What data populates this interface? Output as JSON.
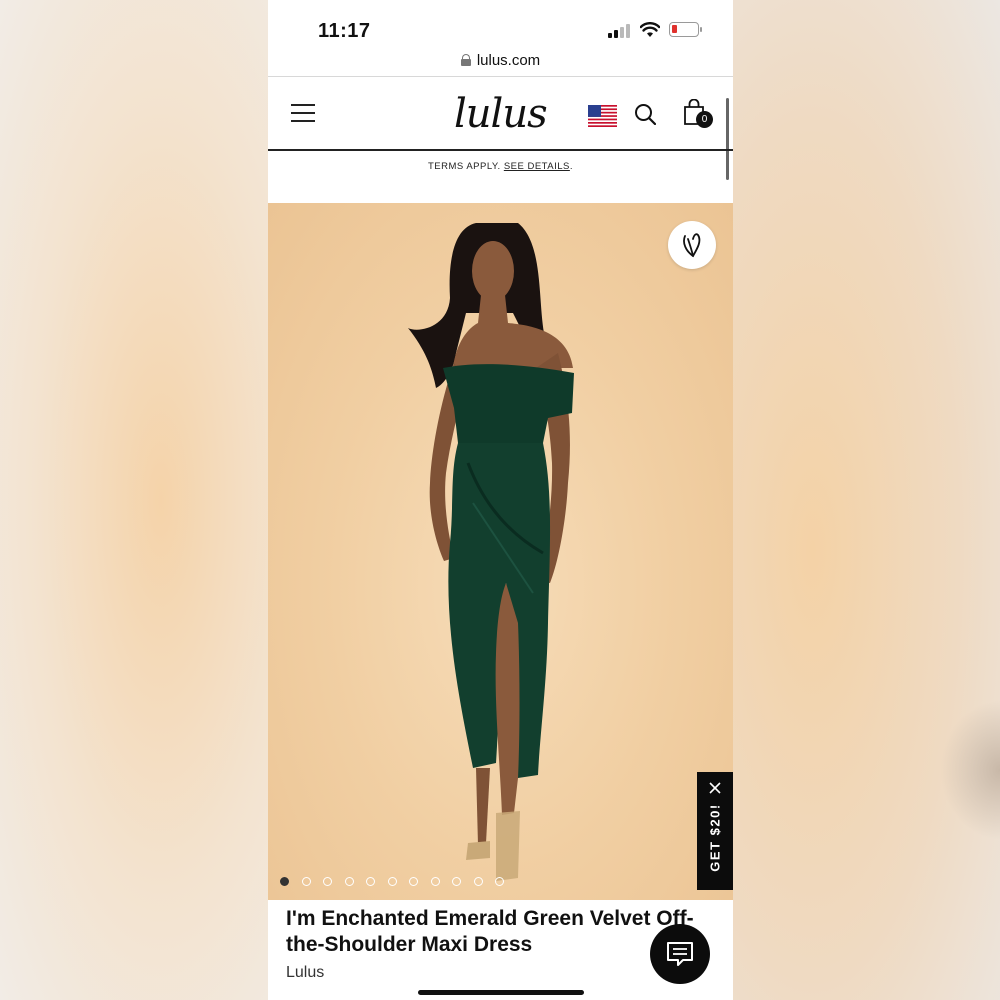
{
  "status_bar": {
    "time": "11:17",
    "icons": [
      "signal-icon",
      "wifi-icon",
      "battery-low-icon"
    ],
    "battery_color": "#e0322e"
  },
  "browser": {
    "url": "lulus.com",
    "icon": "lock-icon"
  },
  "header": {
    "menu_icon": "hamburger-menu-icon",
    "logo": "lulus",
    "flag_icon": "us-flag-icon",
    "search_icon": "search-icon",
    "cart_icon": "shopping-bag-icon",
    "cart_count": "0"
  },
  "promo": {
    "text": "TERMS APPLY. ",
    "link": "SEE DETAILS",
    "suffix": "."
  },
  "product": {
    "image_background": "#f1cfa3",
    "dress_color": "#0f3a2a",
    "wishlist_icon": "heart-icon",
    "carousel": {
      "total": 11,
      "active_index": 0
    },
    "title": "I'm Enchanted Emerald Green Velvet Off-the-Shoulder Maxi Dress",
    "brand": "Lulus"
  },
  "offer_tab": {
    "label": "GET $20!",
    "close_icon": "close-icon"
  },
  "chat": {
    "icon": "chat-bubble-icon"
  }
}
